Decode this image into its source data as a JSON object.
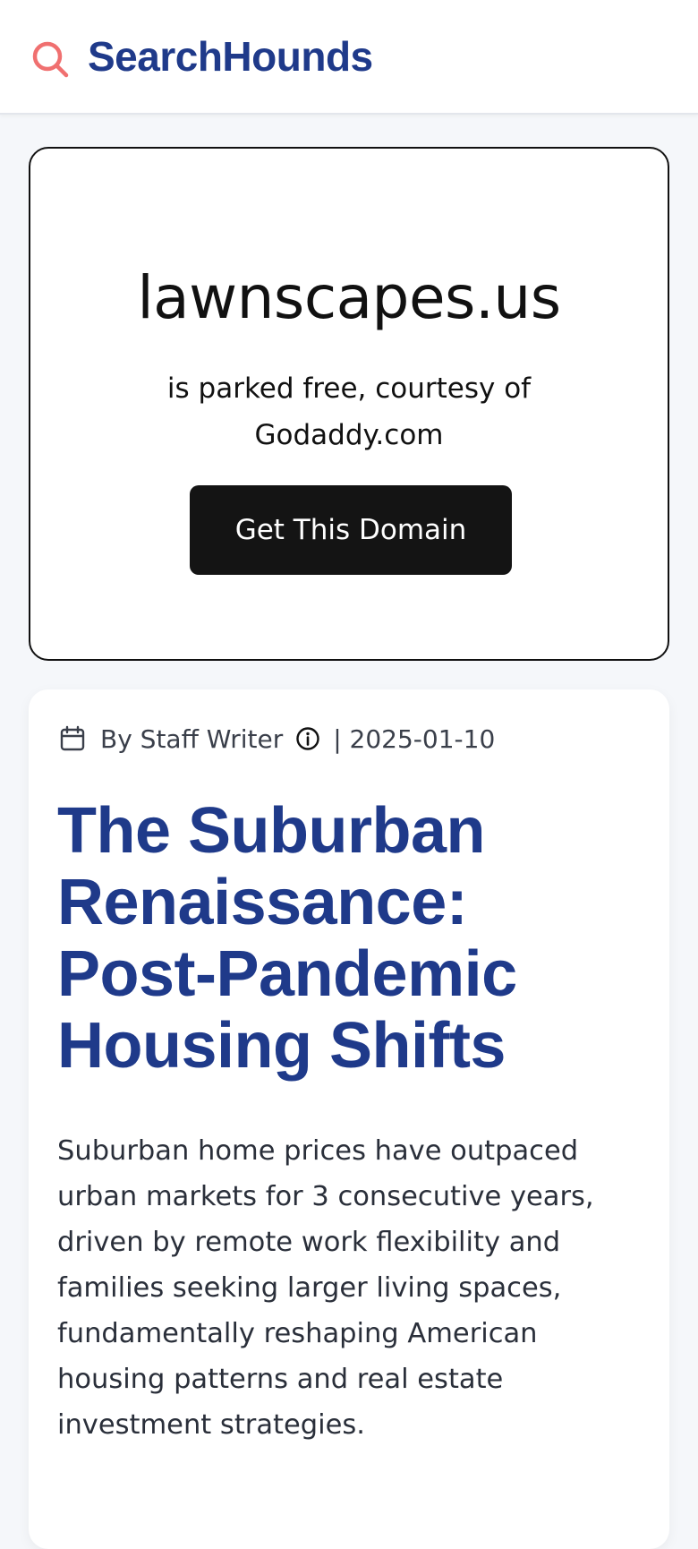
{
  "header": {
    "brand": "SearchHounds",
    "logo_icon": "search-icon",
    "logo_color": "#f07070",
    "brand_color": "#1f3a8a"
  },
  "parking": {
    "domain": "lawnscapes.us",
    "message": "is parked free, courtesy of Godaddy.com",
    "button_label": "Get This Domain"
  },
  "article": {
    "author": "By Staff Writer",
    "date": "| 2025-01-10",
    "title": "The Suburban Renaissance: Post-Pandemic Housing Shifts",
    "body": "Suburban home prices have outpaced urban markets for 3 consecutive years, driven by remote work flexibility and families seeking larger living spaces, fundamentally reshaping American housing patterns and real estate investment strategies."
  }
}
